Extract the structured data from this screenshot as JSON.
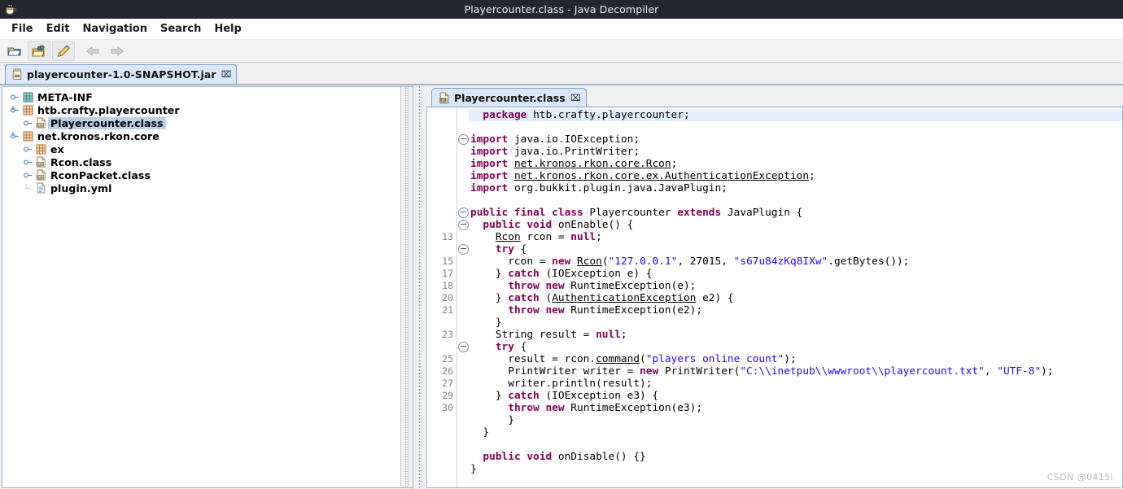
{
  "window": {
    "title": "Playercounter.class - Java Decompiler",
    "app_icon": "coffee-cup-icon"
  },
  "menubar": {
    "items": [
      {
        "label": "File"
      },
      {
        "label": "Edit"
      },
      {
        "label": "Navigation"
      },
      {
        "label": "Search"
      },
      {
        "label": "Help"
      }
    ]
  },
  "toolbar": {
    "buttons": [
      {
        "name": "open-file-button",
        "icon": "open-folder-icon",
        "enabled": true
      },
      {
        "name": "open-type-button",
        "icon": "open-folder-colored-icon",
        "enabled": true
      },
      {
        "name": "edit-button",
        "icon": "pen-icon",
        "enabled": true
      },
      {
        "name": "back-button",
        "icon": "arrow-left-icon",
        "enabled": false
      },
      {
        "name": "forward-button",
        "icon": "arrow-right-icon",
        "enabled": false
      }
    ]
  },
  "jar_tabs": [
    {
      "label": "playercounter-1.0-SNAPSHOT.jar",
      "icon": "jar-icon",
      "close": "⌧",
      "active": true
    }
  ],
  "tree": {
    "nodes": [
      {
        "label": "META-INF",
        "icon": "package-icon-teal",
        "depth": 0,
        "twist": "collapsed",
        "selected": false
      },
      {
        "label": "htb.crafty.playercounter",
        "icon": "package-icon-orange",
        "depth": 0,
        "twist": "expanded",
        "selected": false
      },
      {
        "label": "Playercounter.class",
        "icon": "class-file-icon",
        "depth": 1,
        "twist": "collapsed",
        "selected": true
      },
      {
        "label": "net.kronos.rkon.core",
        "icon": "package-icon-orange",
        "depth": 0,
        "twist": "expanded",
        "selected": false
      },
      {
        "label": "ex",
        "icon": "package-icon-orange",
        "depth": 1,
        "twist": "collapsed",
        "selected": false
      },
      {
        "label": "Rcon.class",
        "icon": "class-file-icon",
        "depth": 1,
        "twist": "collapsed",
        "selected": false
      },
      {
        "label": "RconPacket.class",
        "icon": "class-file-icon",
        "depth": 1,
        "twist": "collapsed",
        "selected": false
      },
      {
        "label": "plugin.yml",
        "icon": "yaml-file-icon",
        "depth": 1,
        "twist": "none",
        "selected": false
      }
    ]
  },
  "editor_tabs": [
    {
      "label": "Playercounter.class",
      "icon": "class-file-icon",
      "close": "⌧",
      "active": true
    }
  ],
  "editor": {
    "lines": [
      {
        "num": "",
        "fold": false,
        "highlight": true,
        "html": "  <span class=\"kw\">package</span> htb.crafty.playercounter;"
      },
      {
        "num": "",
        "fold": false,
        "highlight": false,
        "html": ""
      },
      {
        "num": "",
        "fold": true,
        "highlight": false,
        "html": "<span class=\"kw\">import</span> java.io.IOException;"
      },
      {
        "num": "",
        "fold": false,
        "highlight": false,
        "html": "<span class=\"kw\">import</span> java.io.PrintWriter;"
      },
      {
        "num": "",
        "fold": false,
        "highlight": false,
        "html": "<span class=\"kw\">import</span> <span class=\"lnk\">net.kronos.rkon.core.Rcon</span>;"
      },
      {
        "num": "",
        "fold": false,
        "highlight": false,
        "html": "<span class=\"kw\">import</span> <span class=\"lnk\">net.kronos.rkon.core.ex.AuthenticationException</span>;"
      },
      {
        "num": "",
        "fold": false,
        "highlight": false,
        "html": "<span class=\"kw\">import</span> org.bukkit.plugin.java.JavaPlugin;"
      },
      {
        "num": "",
        "fold": false,
        "highlight": false,
        "html": ""
      },
      {
        "num": "",
        "fold": true,
        "highlight": false,
        "html": "<span class=\"kw\">public final class</span> Playercounter <span class=\"kw\">extends</span> JavaPlugin {"
      },
      {
        "num": "",
        "fold": true,
        "highlight": false,
        "html": "  <span class=\"kw\">public void</span> onEnable() {"
      },
      {
        "num": "13",
        "fold": false,
        "highlight": false,
        "html": "    <span class=\"lnk\">Rcon</span> rcon = <span class=\"kw\">null</span>;"
      },
      {
        "num": "",
        "fold": true,
        "highlight": false,
        "html": "    <span class=\"kw\">try</span> {"
      },
      {
        "num": "15",
        "fold": false,
        "highlight": false,
        "html": "      rcon = <span class=\"kw\">new</span> <span class=\"lnk\">Rcon</span>(<span class=\"str\">\"127.0.0.1\"</span>, 27015, <span class=\"str\">\"s67u84zKq8IXw\"</span>.getBytes());"
      },
      {
        "num": "17",
        "fold": false,
        "highlight": false,
        "html": "    } <span class=\"kw\">catch</span> (IOException e) {"
      },
      {
        "num": "18",
        "fold": false,
        "highlight": false,
        "html": "      <span class=\"kw\">throw new</span> RuntimeException(e);"
      },
      {
        "num": "20",
        "fold": false,
        "highlight": false,
        "html": "    } <span class=\"kw\">catch</span> (<span class=\"lnk\">AuthenticationException</span> e2) {"
      },
      {
        "num": "21",
        "fold": false,
        "highlight": false,
        "html": "      <span class=\"kw\">throw new</span> RuntimeException(e2);"
      },
      {
        "num": "",
        "fold": false,
        "highlight": false,
        "html": "    }"
      },
      {
        "num": "23",
        "fold": false,
        "highlight": false,
        "html": "    String result = <span class=\"kw\">null</span>;"
      },
      {
        "num": "",
        "fold": true,
        "highlight": false,
        "html": "    <span class=\"kw\">try</span> {"
      },
      {
        "num": "25",
        "fold": false,
        "highlight": false,
        "html": "      result = rcon.<span class=\"lnk\">command</span>(<span class=\"str\">\"players online count\"</span>);"
      },
      {
        "num": "26",
        "fold": false,
        "highlight": false,
        "html": "      PrintWriter writer = <span class=\"kw\">new</span> PrintWriter(<span class=\"str\">\"C:\\\\inetpub\\\\wwwroot\\\\playercount.txt\"</span>, <span class=\"str\">\"UTF-8\"</span>);"
      },
      {
        "num": "27",
        "fold": false,
        "highlight": false,
        "html": "      writer.println(result);"
      },
      {
        "num": "29",
        "fold": false,
        "highlight": false,
        "html": "    } <span class=\"kw\">catch</span> (IOException e3) {"
      },
      {
        "num": "30",
        "fold": false,
        "highlight": false,
        "html": "      <span class=\"kw\">throw new</span> RuntimeException(e3);"
      },
      {
        "num": "",
        "fold": false,
        "highlight": false,
        "html": "      }"
      },
      {
        "num": "",
        "fold": false,
        "highlight": false,
        "html": "  }"
      },
      {
        "num": "",
        "fold": false,
        "highlight": false,
        "html": ""
      },
      {
        "num": "",
        "fold": false,
        "highlight": false,
        "html": "  <span class=\"kw\">public void</span> onDisable() {}"
      },
      {
        "num": "",
        "fold": false,
        "highlight": false,
        "html": "}"
      }
    ]
  },
  "watermark": {
    "text": "CSDN @0415i"
  },
  "colors": {
    "titlebar_bg": "#242730",
    "keyword": "#7f0055",
    "string": "#2a00ff",
    "tab_active_bg": "#dbe8f7",
    "selection": "#b9d0e8",
    "highlight_line": "#e4eefc"
  }
}
